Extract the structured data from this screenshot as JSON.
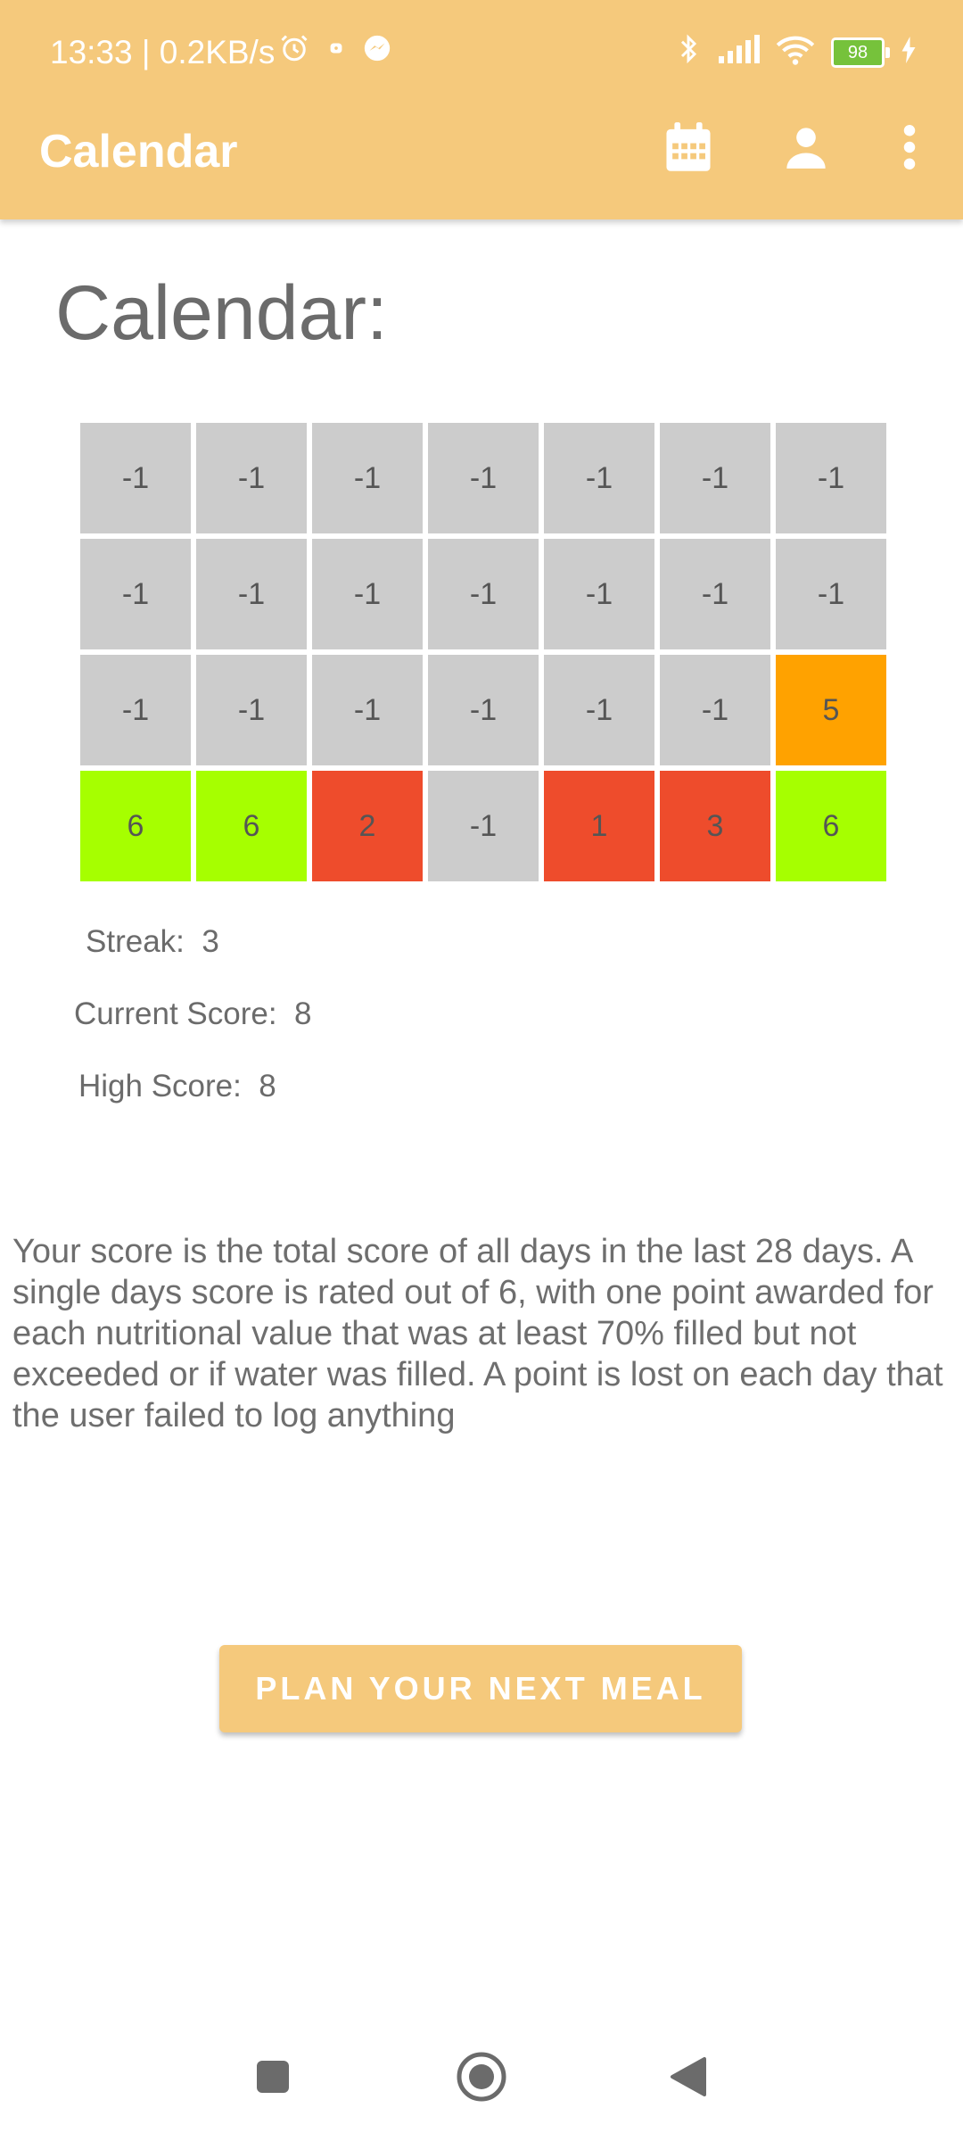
{
  "status_bar": {
    "time_speed": "13:33 | 0.2KB/s",
    "battery_level": "98"
  },
  "app_bar": {
    "title": "Calendar",
    "icons": [
      "calendar-icon",
      "person-icon",
      "more-vert-icon"
    ]
  },
  "page": {
    "heading": "Calendar:"
  },
  "calendar": {
    "rows": [
      [
        {
          "value": "-1",
          "color": "#cccccc"
        },
        {
          "value": "-1",
          "color": "#cccccc"
        },
        {
          "value": "-1",
          "color": "#cccccc"
        },
        {
          "value": "-1",
          "color": "#cccccc"
        },
        {
          "value": "-1",
          "color": "#cccccc"
        },
        {
          "value": "-1",
          "color": "#cccccc"
        },
        {
          "value": "-1",
          "color": "#cccccc"
        }
      ],
      [
        {
          "value": "-1",
          "color": "#cccccc"
        },
        {
          "value": "-1",
          "color": "#cccccc"
        },
        {
          "value": "-1",
          "color": "#cccccc"
        },
        {
          "value": "-1",
          "color": "#cccccc"
        },
        {
          "value": "-1",
          "color": "#cccccc"
        },
        {
          "value": "-1",
          "color": "#cccccc"
        },
        {
          "value": "-1",
          "color": "#cccccc"
        }
      ],
      [
        {
          "value": "-1",
          "color": "#cccccc"
        },
        {
          "value": "-1",
          "color": "#cccccc"
        },
        {
          "value": "-1",
          "color": "#cccccc"
        },
        {
          "value": "-1",
          "color": "#cccccc"
        },
        {
          "value": "-1",
          "color": "#cccccc"
        },
        {
          "value": "-1",
          "color": "#cccccc"
        },
        {
          "value": "5",
          "color": "#ffa200"
        }
      ],
      [
        {
          "value": "6",
          "color": "#a6ff00"
        },
        {
          "value": "6",
          "color": "#a6ff00"
        },
        {
          "value": "2",
          "color": "#ee4c2c"
        },
        {
          "value": "-1",
          "color": "#cccccc"
        },
        {
          "value": "1",
          "color": "#ee4c2c"
        },
        {
          "value": "3",
          "color": "#ee4c2c"
        },
        {
          "value": "6",
          "color": "#a6ff00"
        }
      ]
    ]
  },
  "stats": {
    "streak": "Streak:  3",
    "current_score": "Current Score:  8",
    "high_score": "High Score:  8"
  },
  "info_text": "Your score is the total score of all days in the last 28 days. A single days score is rated out of 6, with one point awarded for each nutritional value that was at least 70% filled but not exceeded or if water was filled. A point is lost on each day that the user failed to log anything",
  "button": {
    "label": "PLAN YOUR NEXT MEAL"
  },
  "colors": {
    "accent": "#f5c97c",
    "empty_day": "#cccccc",
    "good_day": "#a6ff00",
    "ok_day": "#ffa200",
    "bad_day": "#ee4c2c"
  }
}
